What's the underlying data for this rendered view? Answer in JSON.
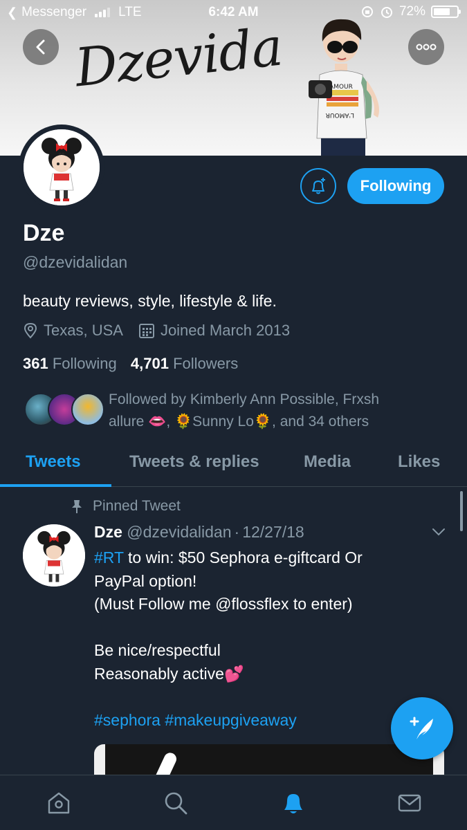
{
  "status_bar": {
    "back_app": "Messenger",
    "carrier": "LTE",
    "time": "6:42 AM",
    "battery": "72%",
    "battery_level": 0.72
  },
  "banner": {
    "title": "Dzevida"
  },
  "profile": {
    "name": "Dze",
    "handle": "@dzevidalidan",
    "bio": "beauty reviews, style, lifestyle & life.",
    "location": "Texas, USA",
    "joined": "Joined March 2013",
    "following_count": "361",
    "following_label": "Following",
    "followers_count": "4,701",
    "followers_label": "Followers",
    "follow_button": "Following",
    "followed_by_line1": "Followed by Kimberly Ann Possible, Frxsh",
    "followed_by_line2": "allure 👄, 🌻Sunny Lo🌻, and 34 others"
  },
  "tabs": [
    {
      "label": "Tweets"
    },
    {
      "label": "Tweets & replies"
    },
    {
      "label": "Media"
    },
    {
      "label": "Likes"
    }
  ],
  "tweet": {
    "pinned_label": "Pinned Tweet",
    "author": "Dze",
    "handle": "@dzevidalidan",
    "dot": "·",
    "date": "12/27/18",
    "hashtag_rt": "#RT",
    "line1_rest": " to win: $50 Sephora e-giftcard Or",
    "line2": "PayPal option!",
    "line3": "(Must Follow me @flossflex to enter)",
    "line4": "Be nice/respectful",
    "line5": "Reasonably active💕",
    "hashtags": "#sephora #makeupgiveaway"
  },
  "colors": {
    "background": "#1b2431",
    "accent": "#1da1f2",
    "muted_text": "#8899a6"
  },
  "icons": {
    "back": "chevron-left-icon",
    "more": "more-dots-icon",
    "notify": "bell-plus-icon",
    "location": "location-pin-icon",
    "calendar": "calendar-icon",
    "pin": "pin-icon",
    "caret": "chevron-down-icon",
    "compose": "compose-feather-icon",
    "nav": [
      "home-icon",
      "search-icon",
      "notifications-icon",
      "messages-icon"
    ]
  }
}
